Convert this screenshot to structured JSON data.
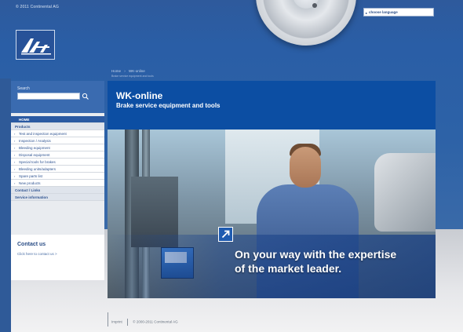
{
  "header": {
    "top_contact": "© 2011 Continental AG",
    "logo_text": "Ate",
    "country_select": "choose language",
    "breadcrumb": [
      "Home",
      "WK-online"
    ],
    "breadcrumb_sub": "Brake service equipment and tools"
  },
  "sidebar": {
    "search_label": "Search",
    "search_placeholder": "",
    "nav_items": [
      {
        "label": "HOME",
        "type": "active"
      },
      {
        "label": "Products",
        "type": "section"
      },
      {
        "label": "Test and inspection equipment",
        "type": "item"
      },
      {
        "label": "Inspection / Analysis",
        "type": "item"
      },
      {
        "label": "Bleeding equipment",
        "type": "item"
      },
      {
        "label": "Disposal equipment",
        "type": "item"
      },
      {
        "label": "Special tools for brakes",
        "type": "item"
      },
      {
        "label": "Bleeding units/adapters",
        "type": "item"
      },
      {
        "label": "Spare parts list",
        "type": "item"
      },
      {
        "label": "New products",
        "type": "item"
      },
      {
        "label": "Contact / Links",
        "type": "section"
      },
      {
        "label": "Service information",
        "type": "section"
      }
    ],
    "contact_title": "Contact us",
    "contact_link": "Click here to contact us >"
  },
  "main": {
    "title": "WK-online",
    "subtitle": "Brake service equipment and tools",
    "hero_caption_line1": "On your way with the expertise",
    "hero_caption_line2": "of the market leader."
  },
  "footer": {
    "imprint": "Imprint",
    "copyright": "© 2000-2011 Continental AG"
  },
  "colors": {
    "brand_blue": "#0c4ea3",
    "nav_active": "#2b5aa2",
    "page_band": "#2d62a7"
  },
  "icons": {
    "search": "magnifier-icon",
    "arrow_badge": "arrow-up-right-icon",
    "logo": "ate-logo"
  }
}
